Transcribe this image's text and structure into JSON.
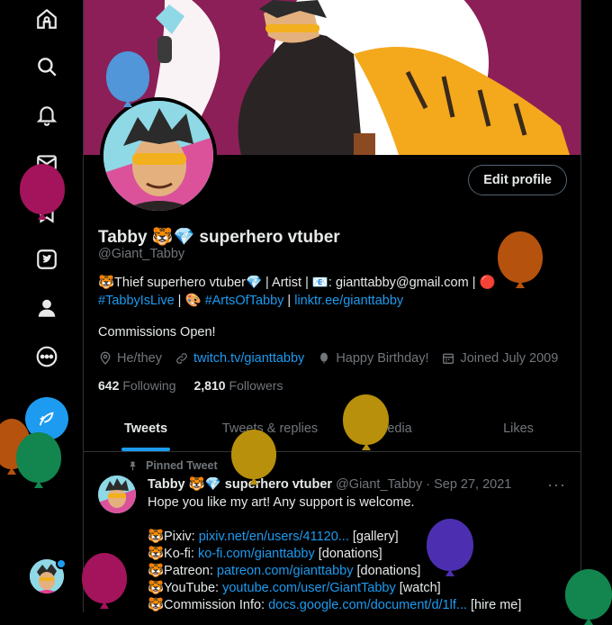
{
  "nav": {
    "items": [
      "home-icon",
      "explore-icon",
      "notifications-icon",
      "messages-icon",
      "bookmarks-icon",
      "twitter-blue-icon",
      "profile-icon",
      "more-icon"
    ]
  },
  "profile": {
    "name": "Tabby 🐯💎 superhero vtuber",
    "handle": "@Giant_Tabby",
    "edit_button": "Edit profile",
    "bio_line1_a": "🐯Thief superhero vtuber💎 | Artist | 📧: gianttabby@gmail.com | 🔴",
    "bio_line2_link1": "#TabbyIsLive",
    "bio_line2_sep": " | 🎨 ",
    "bio_line2_link2": "#ArtsOfTabby",
    "bio_line2_sep2": " | ",
    "bio_line2_link3": "linktr.ee/gianttabby",
    "commissions": "Commissions Open!",
    "pronouns": "He/they",
    "website": "twitch.tv/gianttabby",
    "birthday": "Happy Birthday!",
    "joined": "Joined July 2009",
    "following_count": "642",
    "following_label": "Following",
    "followers_count": "2,810",
    "followers_label": "Followers"
  },
  "tabs": [
    {
      "label": "Tweets",
      "active": true
    },
    {
      "label": "Tweets & replies",
      "active": false
    },
    {
      "label": "Media",
      "active": false
    },
    {
      "label": "Likes",
      "active": false
    }
  ],
  "tweet": {
    "pinned_label": "Pinned Tweet",
    "author": "Tabby 🐯💎 superhero vtuber",
    "handle_date": "@Giant_Tabby · Sep 27, 2021",
    "line1": "Hope you like my art! Any support is welcome.",
    "pixiv_label": "🐯Pixiv: ",
    "pixiv_link": "pixiv.net/en/users/41120...",
    "pixiv_tail": " [gallery]",
    "kofi_label": "🐯Ko-fi: ",
    "kofi_link": "ko-fi.com/gianttabby",
    "kofi_tail": " [donations]",
    "patreon_label": "🐯Patreon: ",
    "patreon_link": "patreon.com/gianttabby",
    "patreon_tail": " [donations]",
    "youtube_label": "🐯YouTube: ",
    "youtube_link": "youtube.com/user/GiantTabby",
    "youtube_tail": " [watch]",
    "commission_label": "🐯Commission Info: ",
    "commission_link": "docs.google.com/document/d/1lf...",
    "commission_tail": " [hire me]"
  },
  "colors": {
    "accent": "#1d9bf0",
    "banner": "#8c1f57"
  }
}
